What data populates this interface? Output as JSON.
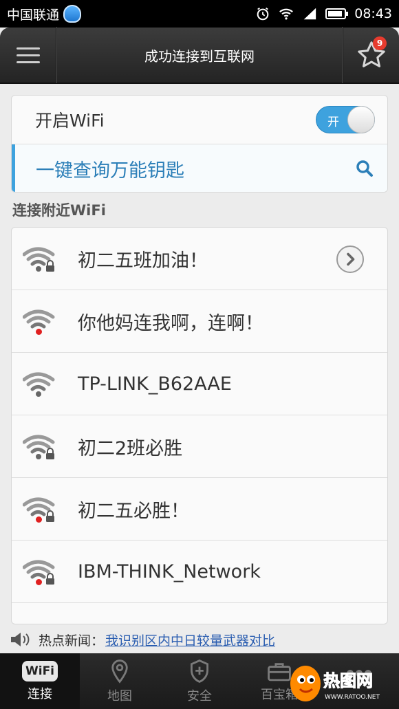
{
  "status_bar": {
    "carrier": "中国联通",
    "time": "08:43"
  },
  "header": {
    "title": "成功连接到互联网",
    "badge_count": "9"
  },
  "wifi_switch": {
    "label": "开启WiFi",
    "state_text": "开"
  },
  "key_search": {
    "label": "一键查询万能钥匙"
  },
  "section_title": "连接附近WiFi",
  "networks": [
    {
      "name": "初二五班加油！",
      "locked": true,
      "red_dot": false,
      "has_arrow": true
    },
    {
      "name": "你他妈连我啊，连啊！",
      "locked": false,
      "red_dot": true,
      "has_arrow": false
    },
    {
      "name": "TP-LINK_B62AAE",
      "locked": false,
      "red_dot": false,
      "has_arrow": false
    },
    {
      "name": "初二2班必胜",
      "locked": true,
      "red_dot": false,
      "has_arrow": false
    },
    {
      "name": "初二五必胜！",
      "locked": true,
      "red_dot": true,
      "has_arrow": false
    },
    {
      "name": "IBM-THINK_Network",
      "locked": true,
      "red_dot": true,
      "has_arrow": false
    }
  ],
  "news": {
    "prefix": "热点新闻：",
    "headline": "我识别区内中日较量武器对比"
  },
  "bottom_nav": {
    "wifi_logo": "WiFi",
    "items": [
      {
        "label": "连接"
      },
      {
        "label": "地图"
      },
      {
        "label": "安全"
      },
      {
        "label": "百宝箱"
      }
    ]
  },
  "watermark": {
    "text": "热图网",
    "url": "WWW.RATOO.NET"
  },
  "colors": {
    "accent": "#3ea2de",
    "badge": "#e63b2e",
    "alert_dot": "#e02020"
  }
}
